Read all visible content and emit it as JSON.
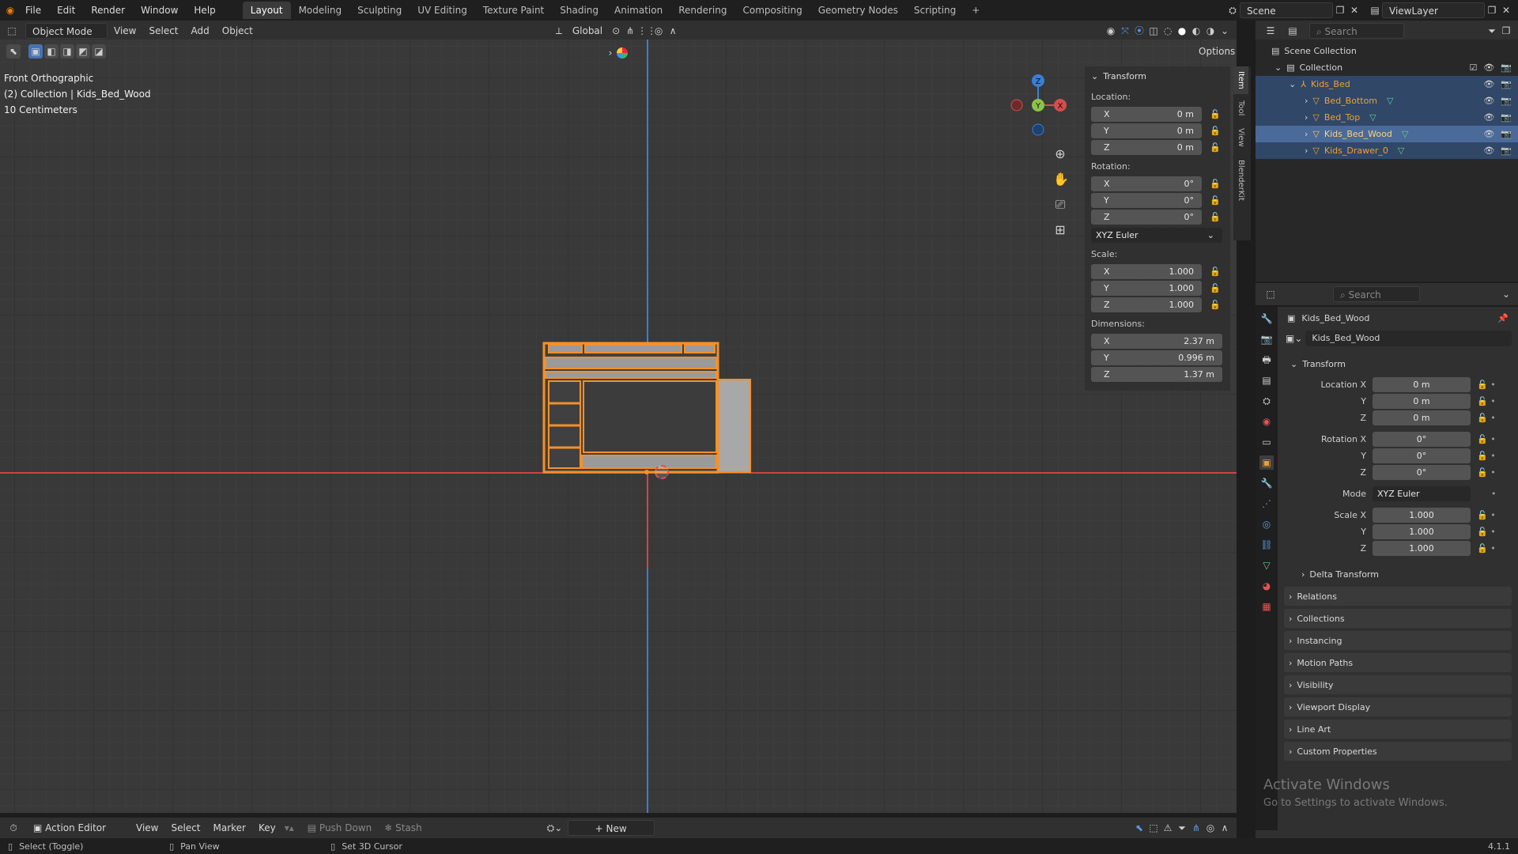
{
  "topbar": {
    "menus": [
      "File",
      "Edit",
      "Render",
      "Window",
      "Help"
    ],
    "workspaces": [
      "Layout",
      "Modeling",
      "Sculpting",
      "UV Editing",
      "Texture Paint",
      "Shading",
      "Animation",
      "Rendering",
      "Compositing",
      "Geometry Nodes",
      "Scripting"
    ],
    "active_workspace": "Layout",
    "add_tab": "+",
    "scene": "Scene",
    "view_layer": "ViewLayer"
  },
  "viewport_header": {
    "mode": "Object Mode",
    "menus": [
      "View",
      "Select",
      "Add",
      "Object"
    ],
    "orientation": "Global",
    "options": "Options"
  },
  "viewport": {
    "view_name": "Front Orthographic",
    "collection_info": "(2) Collection | Kids_Bed_Wood",
    "scale_info": "10 Centimeters",
    "gizmo": {
      "z": "Z",
      "y": "Y",
      "x": "X"
    }
  },
  "npanel": {
    "section": "Transform",
    "tabs": [
      "Item",
      "Tool",
      "View",
      "BlenderKit"
    ],
    "location_label": "Location:",
    "location": [
      {
        "axis": "X",
        "value": "0 m"
      },
      {
        "axis": "Y",
        "value": "0 m"
      },
      {
        "axis": "Z",
        "value": "0 m"
      }
    ],
    "rotation_label": "Rotation:",
    "rotation": [
      {
        "axis": "X",
        "value": "0°"
      },
      {
        "axis": "Y",
        "value": "0°"
      },
      {
        "axis": "Z",
        "value": "0°"
      }
    ],
    "rotation_mode": "XYZ Euler",
    "scale_label": "Scale:",
    "scale": [
      {
        "axis": "X",
        "value": "1.000"
      },
      {
        "axis": "Y",
        "value": "1.000"
      },
      {
        "axis": "Z",
        "value": "1.000"
      }
    ],
    "dimensions_label": "Dimensions:",
    "dimensions": [
      {
        "axis": "X",
        "value": "2.37 m"
      },
      {
        "axis": "Y",
        "value": "0.996 m"
      },
      {
        "axis": "Z",
        "value": "1.37 m"
      }
    ]
  },
  "outliner": {
    "search_placeholder": "Search",
    "scene_collection": "Scene Collection",
    "collection": "Collection",
    "items": [
      {
        "name": "Kids_Bed",
        "level": 1
      },
      {
        "name": "Bed_Bottom",
        "level": 2
      },
      {
        "name": "Bed_Top",
        "level": 2
      },
      {
        "name": "Kids_Bed_Wood",
        "level": 2
      },
      {
        "name": "Kids_Drawer_0",
        "level": 2
      }
    ]
  },
  "properties": {
    "search_placeholder": "Search",
    "object_name": "Kids_Bed_Wood",
    "object_field": "Kids_Bed_Wood",
    "transform_section": "Transform",
    "rows": [
      {
        "label": "Location X",
        "value": "0 m"
      },
      {
        "label": "Y",
        "value": "0 m"
      },
      {
        "label": "Z",
        "value": "0 m"
      },
      {
        "label": "Rotation X",
        "value": "0°"
      },
      {
        "label": "Y",
        "value": "0°"
      },
      {
        "label": "Z",
        "value": "0°"
      },
      {
        "label": "Mode",
        "value": "XYZ Euler"
      },
      {
        "label": "Scale X",
        "value": "1.000"
      },
      {
        "label": "Y",
        "value": "1.000"
      },
      {
        "label": "Z",
        "value": "1.000"
      }
    ],
    "delta_transform": "Delta Transform",
    "sections": [
      "Relations",
      "Collections",
      "Instancing",
      "Motion Paths",
      "Visibility",
      "Viewport Display",
      "Line Art",
      "Custom Properties"
    ]
  },
  "bottom_header": {
    "editor": "Action Editor",
    "menus": [
      "View",
      "Select",
      "Marker",
      "Key"
    ],
    "push_down": "Push Down",
    "stash": "Stash",
    "new_button": "New"
  },
  "statusbar": {
    "select": "Select (Toggle)",
    "pan": "Pan View",
    "cursor": "Set 3D Cursor",
    "version": "4.1.1"
  },
  "watermark": {
    "title": "Activate Windows",
    "subtitle": "Go to Settings to activate Windows."
  },
  "colors": {
    "selection_orange": "#f5902a",
    "axis_red": "#d64d4d",
    "axis_blue": "#3a7fd6",
    "outliner_selected": "#304768",
    "active_text": "#f0a030"
  }
}
